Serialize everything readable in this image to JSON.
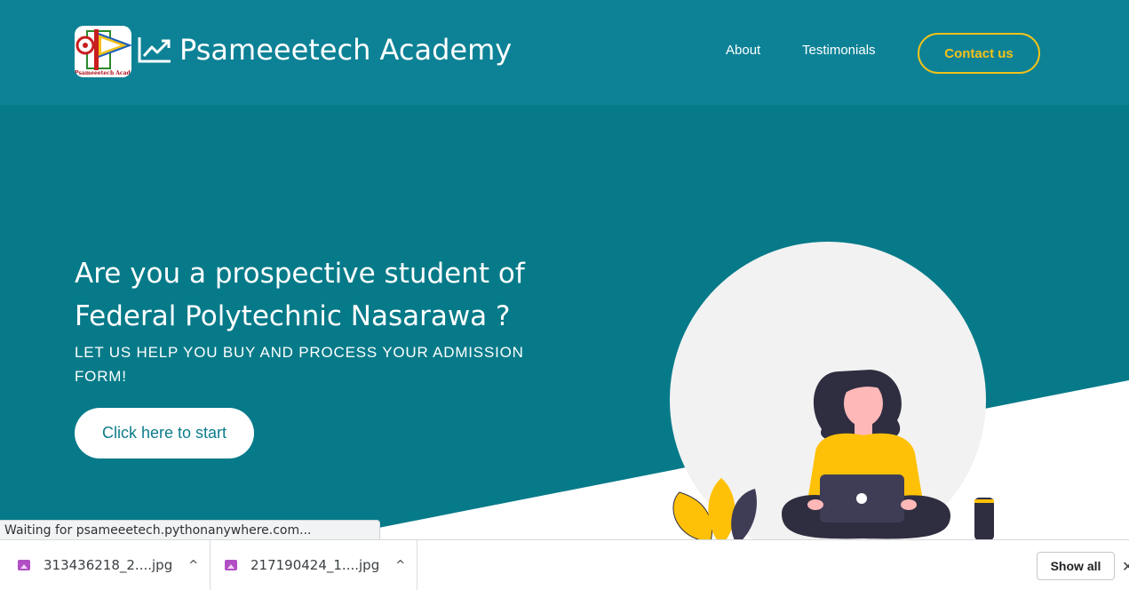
{
  "navbar": {
    "logo_caption": "Psameeetech Academy",
    "brand": "Psameeetech Academy",
    "links": [
      "About",
      "Testimonials"
    ],
    "contact_label": "Contact us",
    "accent_color": "#f2c21a",
    "background": "#0d8296"
  },
  "hero": {
    "headline": "Are you a prospective student of Federal Polytechnic Nasarawa ?",
    "subline": "LET US HELP YOU BUY AND PROCESS YOUR ADMISSION FORM!",
    "cta_label": "Click here to start",
    "background": "#067a89"
  },
  "browser": {
    "status_text": "Waiting for psameeetech.pythonanywhere.com...",
    "downloads": [
      {
        "name": "313436218_2....jpg",
        "icon": "image-file-icon"
      },
      {
        "name": "217190424_1....jpg",
        "icon": "image-file-icon"
      }
    ],
    "show_all_label": "Show all",
    "close_label": "✕"
  }
}
